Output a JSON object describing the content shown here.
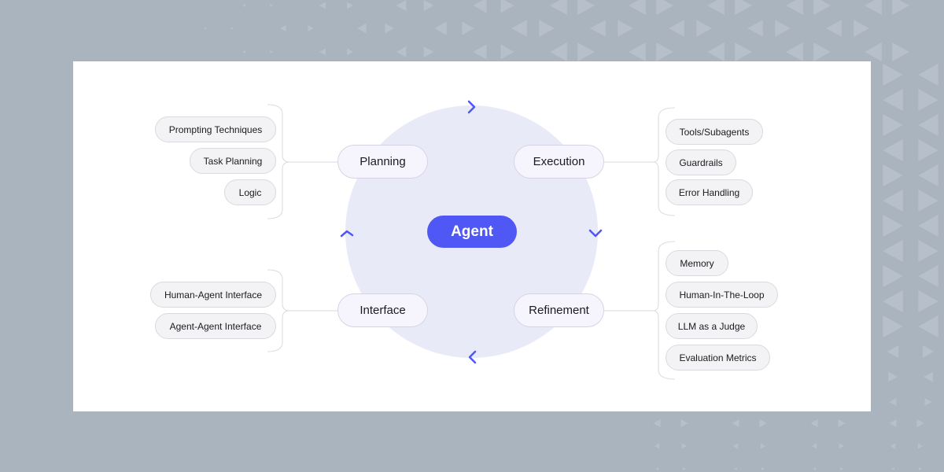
{
  "diagram": {
    "center": {
      "label": "Agent"
    },
    "colors": {
      "accent": "#4f57f5",
      "circle": "#e9eaf7",
      "stage_pill": "#f6f5fe",
      "sub_pill": "#f3f3f6",
      "background": "#a9b4bf",
      "card": "#ffffff"
    },
    "cycle_arrows": [
      "chevron-right",
      "chevron-down",
      "chevron-left",
      "chevron-up"
    ],
    "stages": [
      {
        "label": "Planning",
        "items": [
          "Prompting Techniques",
          "Task Planning",
          "Logic"
        ]
      },
      {
        "label": "Execution",
        "items": [
          "Tools/Subagents",
          "Guardrails",
          "Error Handling"
        ]
      },
      {
        "label": "Refinement",
        "items": [
          "Memory",
          "Human-In-The-Loop",
          "LLM as a Judge",
          "Evaluation Metrics"
        ]
      },
      {
        "label": "Interface",
        "items": [
          "Human-Agent Interface",
          "Agent-Agent Interface"
        ]
      }
    ]
  }
}
